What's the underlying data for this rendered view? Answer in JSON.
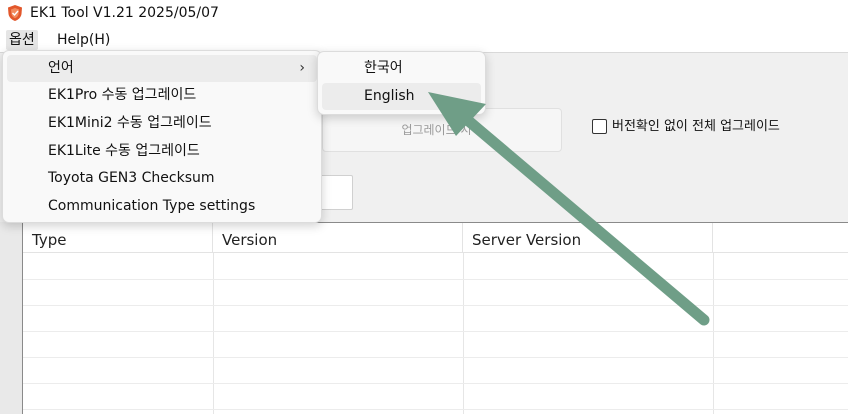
{
  "window": {
    "title": "EK1 Tool V1.21 2025/05/07",
    "icon": "shield-icon",
    "icon_color": "#e2572b"
  },
  "menubar": {
    "options_label": "옵션",
    "help_label": "Help(H)"
  },
  "options_menu": {
    "items": [
      {
        "label": "언어",
        "has_submenu": true
      },
      {
        "label": "EK1Pro 수동 업그레이드"
      },
      {
        "label": "EK1Mini2 수동 업그레이드"
      },
      {
        "label": "EK1Lite 수동 업그레이드"
      },
      {
        "label": "Toyota GEN3 Checksum"
      },
      {
        "label": "Communication Type settings"
      }
    ],
    "submenu_arrow": "›"
  },
  "language_submenu": {
    "items": [
      {
        "label": "한국어"
      },
      {
        "label": "English"
      }
    ]
  },
  "main": {
    "upgrade_button_label": "업그레이드 시작",
    "full_upgrade_checkbox_label": "버전확인 없이 전체 업그레이드",
    "full_upgrade_checked": false
  },
  "table": {
    "columns": [
      "Type",
      "Version",
      "Server Version",
      ""
    ]
  },
  "annotation": {
    "arrow_color": "#6f9e87"
  }
}
